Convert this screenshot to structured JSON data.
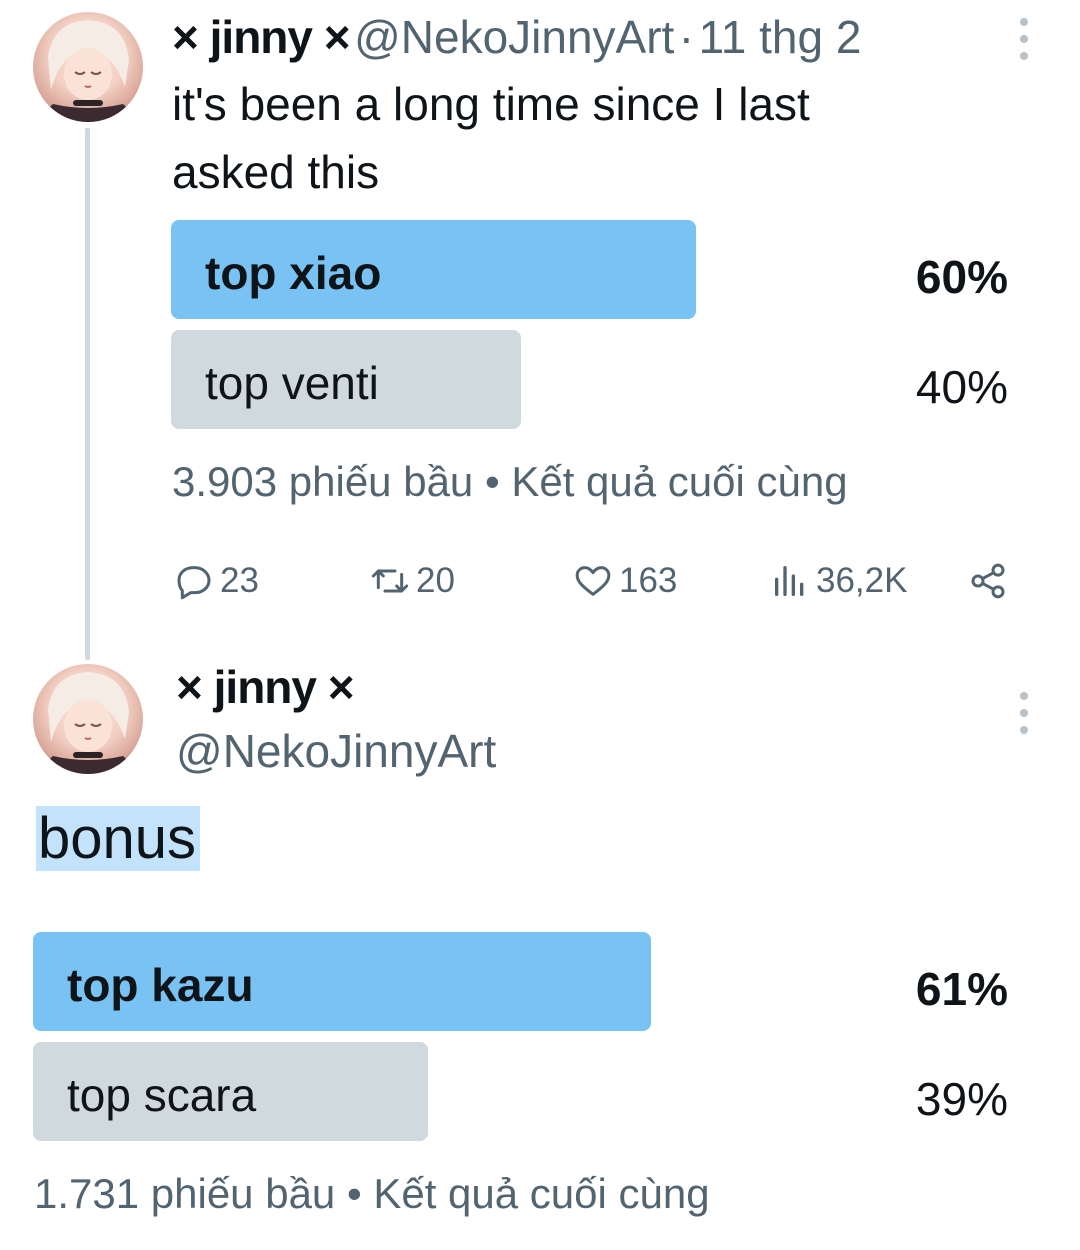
{
  "tweet1": {
    "author_name": "× jinny ×",
    "handle": "@NekoJinnyArt",
    "separator": "·",
    "date": "11 thg 2",
    "text": "it's been a long time since I last asked this",
    "poll": {
      "options": [
        {
          "label": "top xiao",
          "percent_text": "60%",
          "percent": 60,
          "winner": true
        },
        {
          "label": "top venti",
          "percent_text": "40%",
          "percent": 40,
          "winner": false
        }
      ],
      "votes_text": "3.903 phiếu bầu",
      "status_text": "Kết quả cuối cùng",
      "dot": "•"
    },
    "actions": {
      "replies": "23",
      "reposts": "20",
      "likes": "163",
      "views": "36,2K"
    }
  },
  "tweet2": {
    "author_name": "× jinny ×",
    "handle": "@NekoJinnyArt",
    "text": "bonus",
    "poll": {
      "options": [
        {
          "label": "top kazu",
          "percent_text": "61%",
          "percent": 61,
          "winner": true
        },
        {
          "label": "top scara",
          "percent_text": "39%",
          "percent": 39,
          "winner": false
        }
      ],
      "votes_text": "1.731 phiếu bầu",
      "status_text": "Kết quả cuối cùng",
      "dot": "•"
    }
  },
  "colors": {
    "winner_bar": "#78c3f4",
    "loser_bar": "#cfd9de",
    "secondary_text": "#536471",
    "selection_highlight": "#c3e2fb"
  },
  "icons": [
    "avatar",
    "more-dots-icon",
    "reply-icon",
    "repost-icon",
    "like-icon",
    "views-icon",
    "share-icon"
  ]
}
